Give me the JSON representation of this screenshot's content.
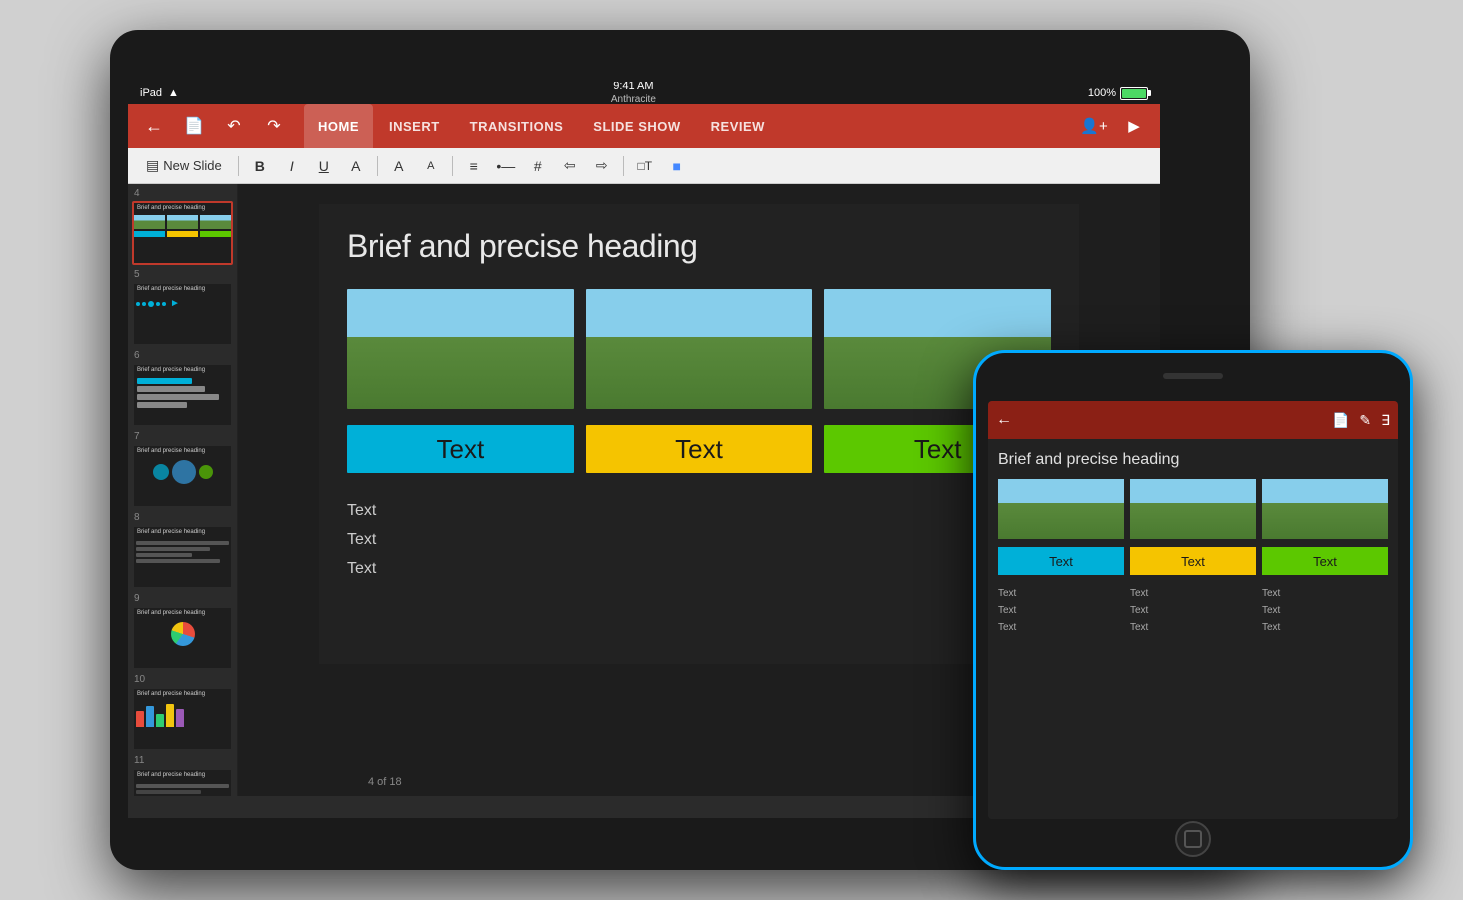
{
  "ipad": {
    "status": {
      "device": "iPad",
      "wifi": "wifi",
      "time": "9:41 AM",
      "subtitle": "Anthracite",
      "battery": "100%"
    },
    "nav": {
      "tabs": [
        "HOME",
        "INSERT",
        "TRANSITIONS",
        "SLIDE SHOW",
        "REVIEW"
      ],
      "active_tab": "HOME"
    },
    "format_bar": {
      "new_slide": "New Slide"
    },
    "slide": {
      "heading": "Brief and precise heading",
      "labels": [
        "Text",
        "Text",
        "Text"
      ],
      "label_colors": [
        "cyan",
        "yellow",
        "green"
      ],
      "text_items": [
        "Text",
        "Text",
        "Text"
      ],
      "status": "4 of 18"
    },
    "thumbnails": [
      {
        "num": "4",
        "title": "Brief and precise heading",
        "type": "images"
      },
      {
        "num": "5",
        "title": "Brief and precise heading",
        "type": "dots"
      },
      {
        "num": "6",
        "title": "Brief and precise heading",
        "type": "steps"
      },
      {
        "num": "7",
        "title": "Brief and precise heading",
        "type": "bubbles"
      },
      {
        "num": "8",
        "title": "Brief and precise heading",
        "type": "lines"
      },
      {
        "num": "9",
        "title": "Brief and precise heading",
        "type": "pie"
      },
      {
        "num": "10",
        "title": "Brief and precise heading",
        "type": "bars"
      },
      {
        "num": "11",
        "title": "Brief and precise heading",
        "type": "plain"
      }
    ]
  },
  "iphone": {
    "nav": {
      "back_icon": "←",
      "icons": [
        "📄",
        "✎",
        "⊞"
      ]
    },
    "slide": {
      "heading": "Brief and precise heading",
      "labels": [
        "Text",
        "Text",
        "Text"
      ],
      "label_colors": [
        "cyan",
        "yellow",
        "green"
      ],
      "text_col1": [
        "Text",
        "Text",
        "Text"
      ],
      "text_col2": [
        "Text",
        "Text",
        "Text"
      ],
      "text_col3": [
        "Text",
        "Text",
        "Text"
      ]
    }
  },
  "colors": {
    "accent_red": "#c0392b",
    "cyan": "#00b0d8",
    "yellow": "#f5c400",
    "green": "#5cc800",
    "iphone_border": "#00aaff"
  }
}
